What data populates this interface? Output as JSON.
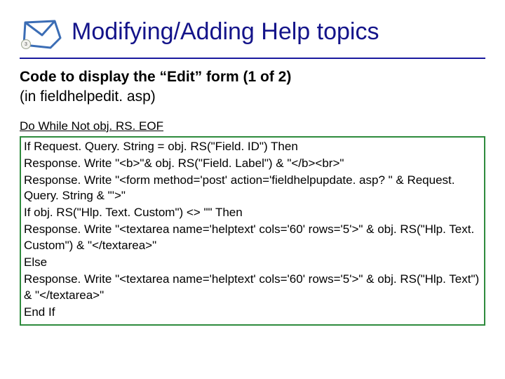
{
  "header": {
    "title": "Modifying/Adding Help topics",
    "icon_badge": "3"
  },
  "subtitle": {
    "line1_bold": "Code to display the “Edit” form (1 of 2)",
    "line2": "(in fieldhelpedit. asp)"
  },
  "code": {
    "line1": "Do While Not obj. RS. EOF",
    "boxed": [
      "If Request. Query. String = obj. RS(\"Field. ID\") Then",
      "Response. Write \"<b>\"& obj. RS(\"Field. Label\") & \"</b><br>\"",
      "Response. Write \"<form method='post' action='fieldhelpupdate. asp? \" & Request. Query. String & \"'>\"",
      "If obj. RS(\"Hlp. Text. Custom\") <> \"\" Then",
      "Response. Write \"<textarea name='helptext' cols='60' rows='5'>\" & obj. RS(\"Hlp. Text. Custom\") & \"</textarea>\"",
      "Else",
      "Response. Write \"<textarea name='helptext' cols='60' rows='5'>\" & obj. RS(\"Hlp. Text\") & \"</textarea>\"",
      "End If"
    ]
  }
}
